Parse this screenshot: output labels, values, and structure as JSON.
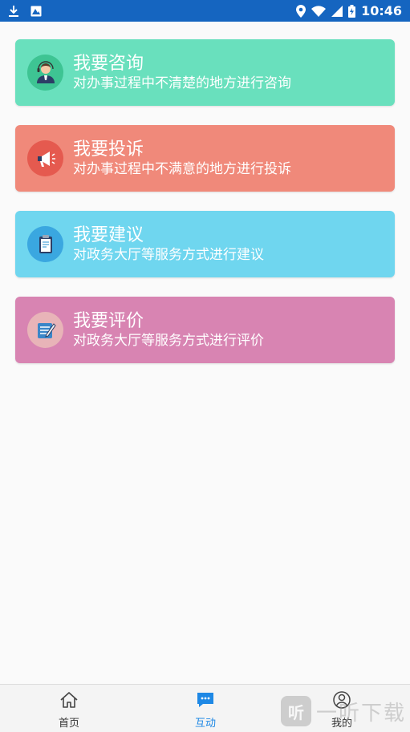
{
  "status_bar": {
    "time": "10:46",
    "icons": [
      "download-icon",
      "image-icon",
      "location-icon",
      "wifi-icon",
      "signal-icon",
      "battery-icon"
    ]
  },
  "cards": [
    {
      "title": "我要咨询",
      "desc": "对办事过程中不清楚的地方进行咨询",
      "color": "#69e0bd",
      "icon": "consult-icon",
      "icon_bg": "#3ec493"
    },
    {
      "title": "我要投诉",
      "desc": "对办事过程中不满意的地方进行投诉",
      "color": "#f0897a",
      "icon": "megaphone-icon",
      "icon_bg": "#e55a4f"
    },
    {
      "title": "我要建议",
      "desc": "对政务大厅等服务方式进行建议",
      "color": "#6fd6ef",
      "icon": "clipboard-icon",
      "icon_bg": "#3aa7e0"
    },
    {
      "title": "我要评价",
      "desc": "对政务大厅等服务方式进行评价",
      "color": "#d884b2",
      "icon": "rating-icon",
      "icon_bg": "#e8b4b8"
    }
  ],
  "tabbar": {
    "tabs": [
      {
        "label": "首页",
        "icon": "home-icon"
      },
      {
        "label": "互动",
        "icon": "chat-icon"
      },
      {
        "label": "我的",
        "icon": "user-icon"
      }
    ],
    "active_index": 1,
    "active_color": "#1e88e5"
  },
  "watermark": {
    "text": "一听下载",
    "logo_glyph": "听"
  }
}
